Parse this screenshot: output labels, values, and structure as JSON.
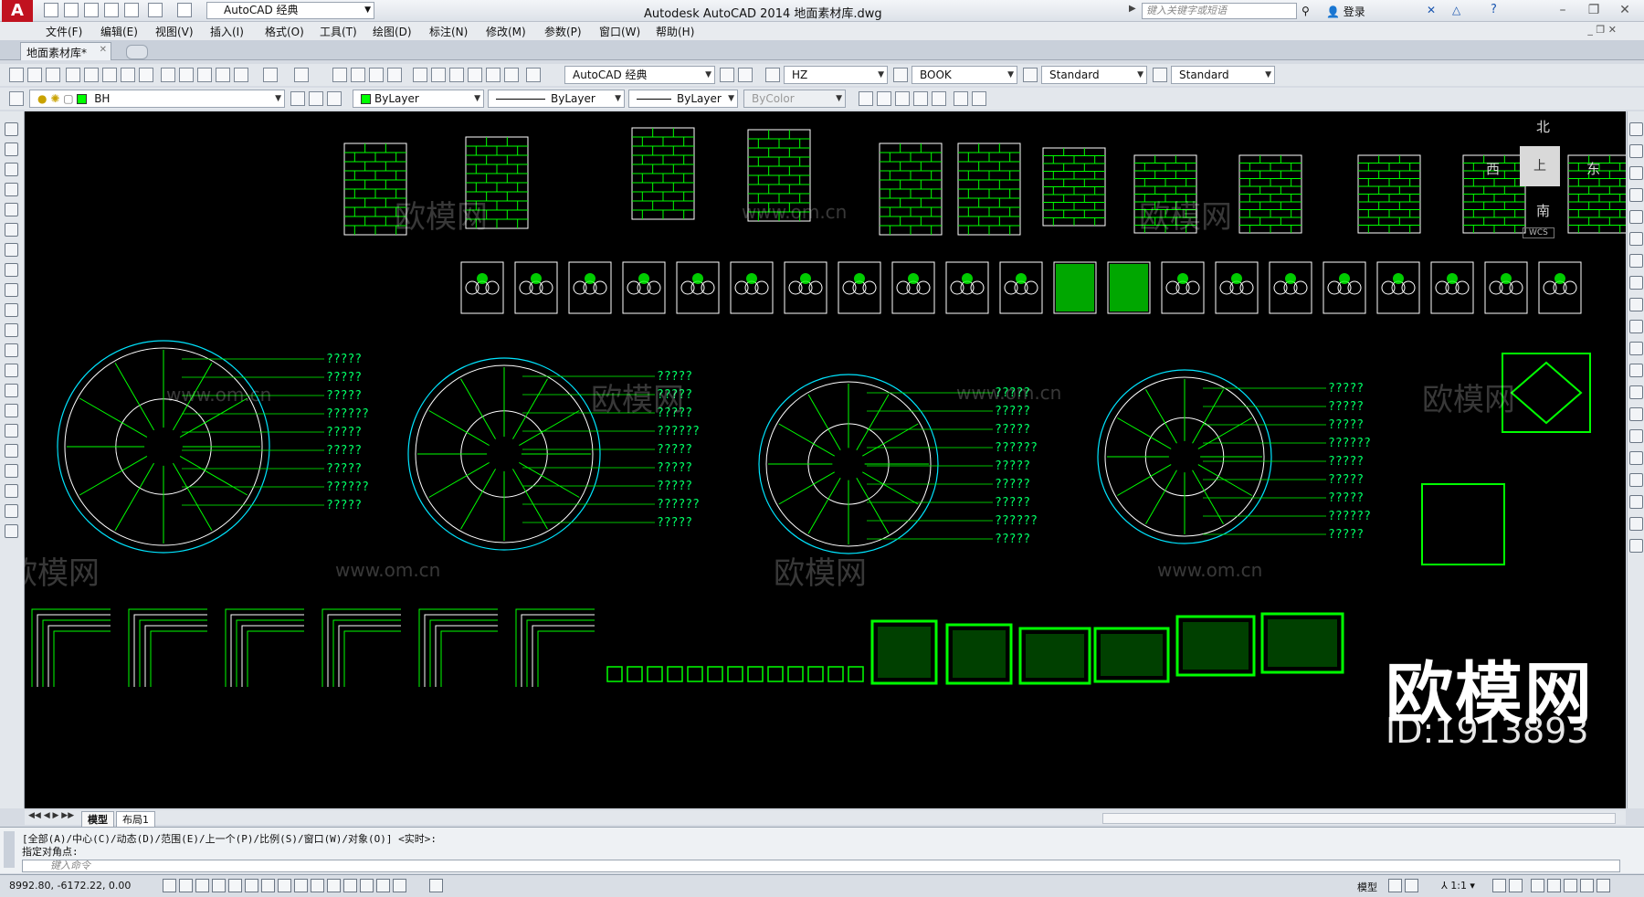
{
  "app": {
    "logo": "A",
    "workspace": "AutoCAD 经典",
    "title": "Autodesk AutoCAD 2014    地面素材库.dwg",
    "search_placeholder": "键入关键字或短语",
    "login": "登录"
  },
  "menu": [
    "文件(F)",
    "编辑(E)",
    "视图(V)",
    "插入(I)",
    "格式(O)",
    "工具(T)",
    "绘图(D)",
    "标注(N)",
    "修改(M)",
    "参数(P)",
    "窗口(W)",
    "帮助(H)"
  ],
  "tabs": {
    "document": "地面素材库*"
  },
  "toolbar1": {
    "workspace_combo": "AutoCAD 经典",
    "text_style": "HZ",
    "font": "BOOK",
    "dim_style": "Standard",
    "table_style": "Standard"
  },
  "toolbar2": {
    "layer": "BH",
    "color": "ByLayer",
    "linetype": "ByLayer",
    "lineweight": "ByLayer",
    "plotstyle": "ByColor"
  },
  "viewcube": {
    "north": "北",
    "south": "南",
    "east": "东",
    "west": "西",
    "top": "上",
    "wcs": "WCS"
  },
  "callout_label": "?????",
  "callout_label_long": "??????",
  "layout_tabs": [
    "模型",
    "布局1"
  ],
  "command": {
    "history": "[全部(A)/中心(C)/动态(D)/范围(E)/上一个(P)/比例(S)/窗口(W)/对象(O)] <实时>:",
    "prompt": "指定对角点:",
    "input_placeholder": "键入命令"
  },
  "status": {
    "coordinates": "8992.80,  -6172.22,  0.00",
    "model": "模型",
    "scale": "1:1"
  },
  "watermark": {
    "brand": "欧模网",
    "url": "www.om.cn",
    "id": "ID:1913893"
  },
  "colors": {
    "cad_green": "#00ff00",
    "cad_cyan": "#00e5ff",
    "canvas": "#000000",
    "logo_red": "#c1121f"
  }
}
